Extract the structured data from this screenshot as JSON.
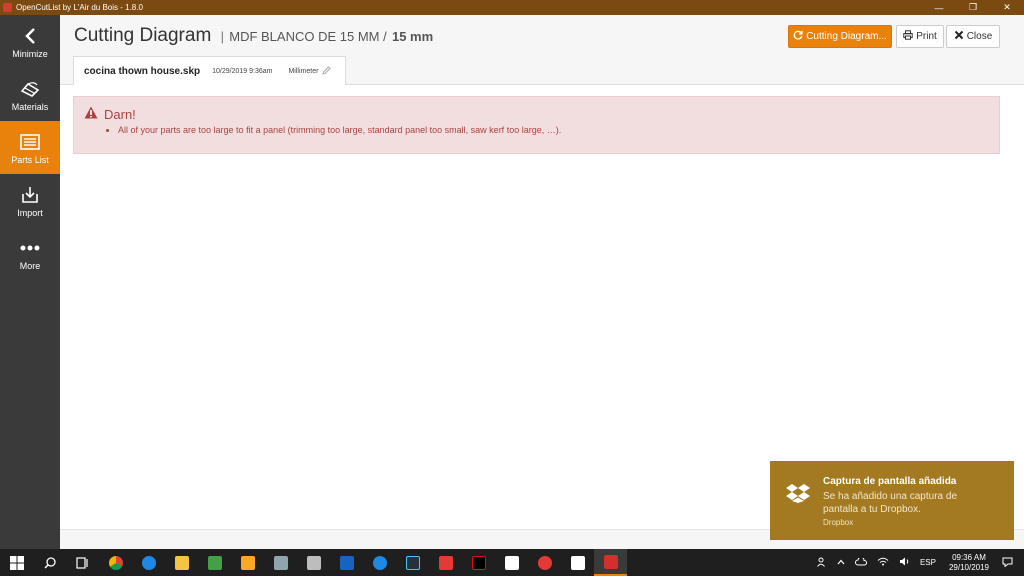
{
  "window": {
    "title": "OpenCutList by L'Air du Bois - 1.8.0",
    "minimize_glyph": "—",
    "restore_glyph": "❐",
    "close_glyph": "✕"
  },
  "sidebar": {
    "items": [
      {
        "label": "Minimize",
        "icon": "chevron-left-icon"
      },
      {
        "label": "Materials",
        "icon": "materials-icon"
      },
      {
        "label": "Parts List",
        "icon": "list-icon",
        "active": true
      },
      {
        "label": "Import",
        "icon": "import-icon"
      },
      {
        "label": "More",
        "icon": "dots-icon"
      }
    ]
  },
  "header": {
    "title": "Cutting Diagram",
    "separator": "|",
    "material": "MDF BLANCO DE 15 MM /",
    "thickness": "15 mm",
    "buttons": {
      "cutting": "Cutting Diagram...",
      "print": "Print",
      "close": "Close"
    }
  },
  "tab": {
    "filename": "cocina thown house.skp",
    "date": "10/29/2019 9:36am",
    "unit": "Millimeter"
  },
  "alert": {
    "heading": "Darn!",
    "message": "All of your parts are too large to fit a panel (trimming too large, standard panel too small, saw kerf too large, …)."
  },
  "toast": {
    "title": "Captura de pantalla añadida",
    "body": "Se ha añadido una captura de pantalla a tu Dropbox.",
    "source": "Dropbox"
  },
  "taskbar": {
    "language": "ESP",
    "time": "09:36 AM",
    "date": "29/10/2019",
    "colors": {
      "accent": "#e8820c",
      "sidebar": "#3a3a3a",
      "titlebar": "#7a4a12",
      "alert_bg": "#f2dede",
      "alert_text": "#a94442",
      "toast_bg": "#a37a22"
    }
  }
}
